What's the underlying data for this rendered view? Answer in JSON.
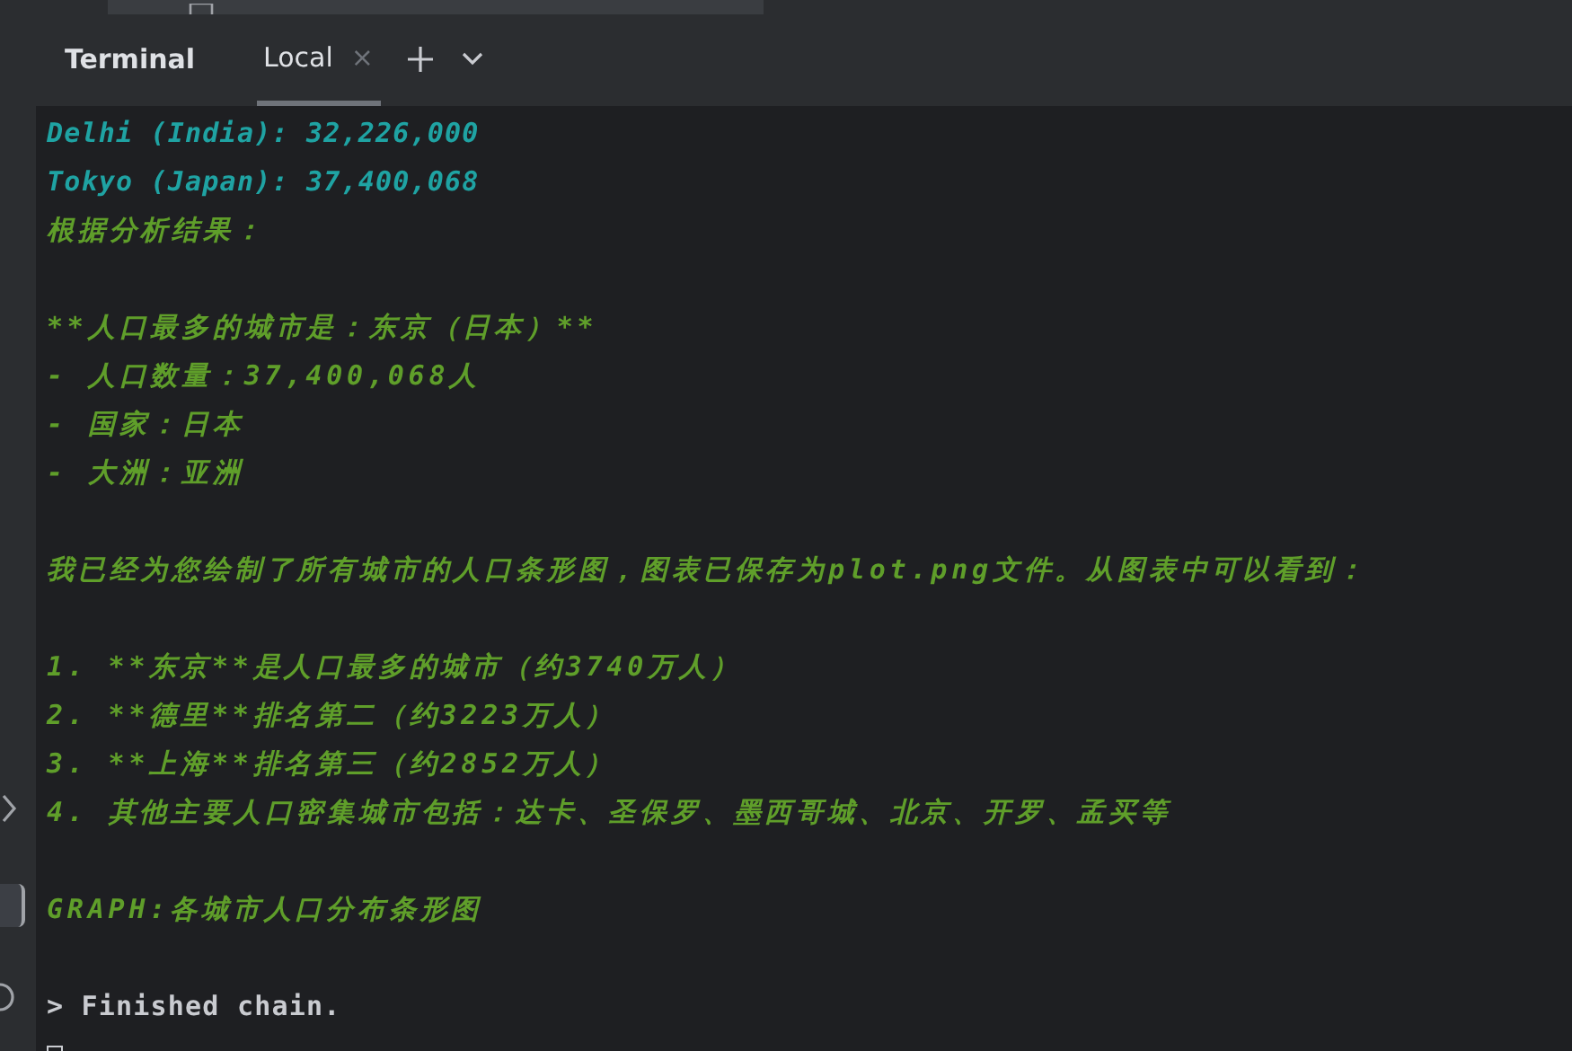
{
  "header": {
    "title": "Terminal",
    "tabs": [
      {
        "label": "Local",
        "selected": true,
        "close": "×"
      }
    ]
  },
  "lines": [
    {
      "kind": "value",
      "text": "Delhi (India): 32,226,000"
    },
    {
      "kind": "value",
      "text": "Tokyo (Japan): 37,400,068"
    },
    {
      "kind": "answer",
      "text": "根据分析结果："
    },
    {
      "kind": "blank"
    },
    {
      "kind": "answer",
      "text": "**人口最多的城市是：东京（日本）**"
    },
    {
      "kind": "answer",
      "text": "- 人口数量：37,400,068人"
    },
    {
      "kind": "answer",
      "text": "- 国家：日本"
    },
    {
      "kind": "answer",
      "text": "- 大洲：亚洲"
    },
    {
      "kind": "blank"
    },
    {
      "kind": "answer",
      "text": "我已经为您绘制了所有城市的人口条形图，图表已保存为plot.png文件。从图表中可以看到："
    },
    {
      "kind": "blank"
    },
    {
      "kind": "answer",
      "text": "1. **东京**是人口最多的城市（约3740万人）"
    },
    {
      "kind": "answer",
      "text": "2. **德里**排名第二（约3223万人）"
    },
    {
      "kind": "answer",
      "text": "3. **上海**排名第三（约2852万人）"
    },
    {
      "kind": "answer",
      "text": "4. 其他主要人口密集城市包括：达卡、圣保罗、墨西哥城、北京、开罗、孟买等"
    },
    {
      "kind": "blank"
    },
    {
      "kind": "answer",
      "text": "GRAPH:各城市人口分布条形图"
    },
    {
      "kind": "blank"
    },
    {
      "kind": "plain",
      "text": "> Finished chain."
    },
    {
      "kind": "cursor"
    }
  ]
}
